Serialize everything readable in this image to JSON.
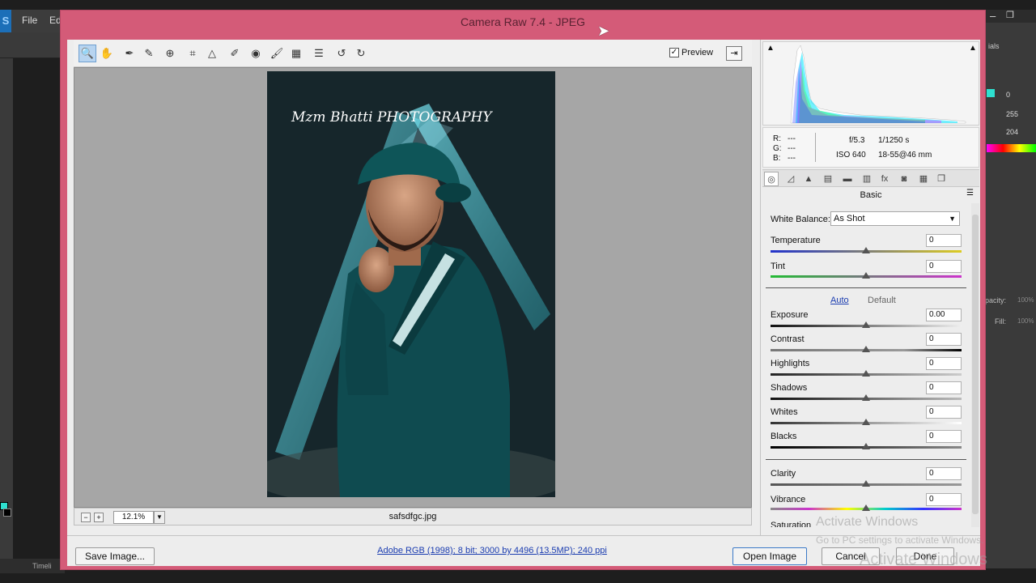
{
  "app": {
    "menu": [
      "File",
      "Ed"
    ],
    "right_panel_title": "ials",
    "right_values": [
      "0",
      "255",
      "204"
    ],
    "right_labels": [
      "pacity:",
      "Fill:"
    ],
    "right_pcts": [
      "100%",
      "100%"
    ],
    "timeline": "Timeli"
  },
  "dialog": {
    "title": "Camera Raw 7.4  -  JPEG"
  },
  "toolbar": {
    "tools": [
      "zoom-icon",
      "hand-icon",
      "white-balance-icon",
      "color-sampler-icon",
      "targeted-adjustment-icon",
      "crop-icon",
      "straighten-icon",
      "spot-removal-icon",
      "red-eye-icon",
      "adjustment-brush-icon",
      "graduated-filter-icon",
      "preferences-icon",
      "rotate-left-icon",
      "rotate-right-icon"
    ],
    "preview_label": "Preview",
    "preview_checked": true
  },
  "canvas": {
    "zoom": "12.1%",
    "filename": "safsdfgc.jpg",
    "photo_signature": "Mzm Bhatti PHOTOGRAPHY"
  },
  "histogram": {
    "rgb_labels": [
      "R:",
      "G:",
      "B:"
    ],
    "rgb_values": [
      "---",
      "---",
      "---"
    ],
    "aperture": "f/5.3",
    "shutter": "1/1250 s",
    "iso": "ISO 640",
    "lens": "18-55@46 mm"
  },
  "panel": {
    "title": "Basic",
    "white_balance_label": "White Balance:",
    "white_balance_value": "As Shot",
    "temperature": {
      "label": "Temperature",
      "value": "0"
    },
    "tint": {
      "label": "Tint",
      "value": "0"
    },
    "auto_label": "Auto",
    "default_label": "Default",
    "exposure": {
      "label": "Exposure",
      "value": "0.00"
    },
    "contrast": {
      "label": "Contrast",
      "value": "0"
    },
    "highlights": {
      "label": "Highlights",
      "value": "0"
    },
    "shadows": {
      "label": "Shadows",
      "value": "0"
    },
    "whites": {
      "label": "Whites",
      "value": "0"
    },
    "blacks": {
      "label": "Blacks",
      "value": "0"
    },
    "clarity": {
      "label": "Clarity",
      "value": "0"
    },
    "vibrance": {
      "label": "Vibrance",
      "value": "0"
    },
    "saturation": {
      "label": "Saturation"
    }
  },
  "bottom": {
    "save_label": "Save Image...",
    "workflow": "Adobe RGB (1998); 8 bit; 3000 by 4496 (13.5MP); 240 ppi",
    "open_label": "Open Image",
    "cancel_label": "Cancel",
    "done_label": "Done"
  },
  "watermark": {
    "line1": "Activate Windows",
    "line2": "Go to PC settings to activate Windows.",
    "line3": "Activate Windows"
  }
}
